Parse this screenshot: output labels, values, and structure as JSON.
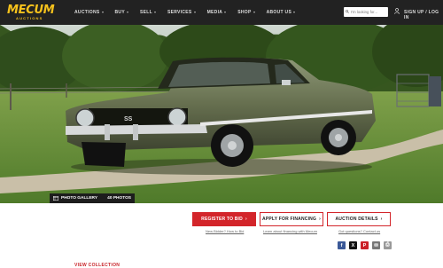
{
  "header": {
    "logo_text": "MECUM",
    "logo_sub": "AUCTIONS",
    "nav": [
      {
        "label": "AUCTIONS"
      },
      {
        "label": "BUY"
      },
      {
        "label": "SELL"
      },
      {
        "label": "SERVICES"
      },
      {
        "label": "MEDIA"
      },
      {
        "label": "SHOP"
      },
      {
        "label": "ABOUT US"
      }
    ],
    "search_placeholder": "I'm looking for...",
    "signin_label": "SIGN UP / LOG IN"
  },
  "gallery": {
    "label": "PHOTO GALLERY",
    "count": "40 PHOTOS"
  },
  "actions": {
    "register_label": "REGISTER TO BID",
    "finance_label": "APPLY FOR FINANCING",
    "details_label": "AUCTION DETAILS",
    "register_sub": "New Bidder? How to Bid",
    "finance_sub": "Learn about financing with Mecum",
    "details_sub": "Got questions? Contact us"
  },
  "social": [
    {
      "icon": "facebook-icon",
      "glyph": "f",
      "color": "#3b5998"
    },
    {
      "icon": "x-icon",
      "glyph": "X",
      "color": "#111111"
    },
    {
      "icon": "pinterest-icon",
      "glyph": "P",
      "color": "#cb2027"
    },
    {
      "icon": "email-icon",
      "glyph": "✉",
      "color": "#777777"
    },
    {
      "icon": "print-icon",
      "glyph": "⎙",
      "color": "#999999"
    }
  ],
  "view_collection_label": "VIEW COLLECTION",
  "colors": {
    "accent": "#d3252a",
    "logo": "#f6c21c",
    "topbar": "#222222"
  }
}
